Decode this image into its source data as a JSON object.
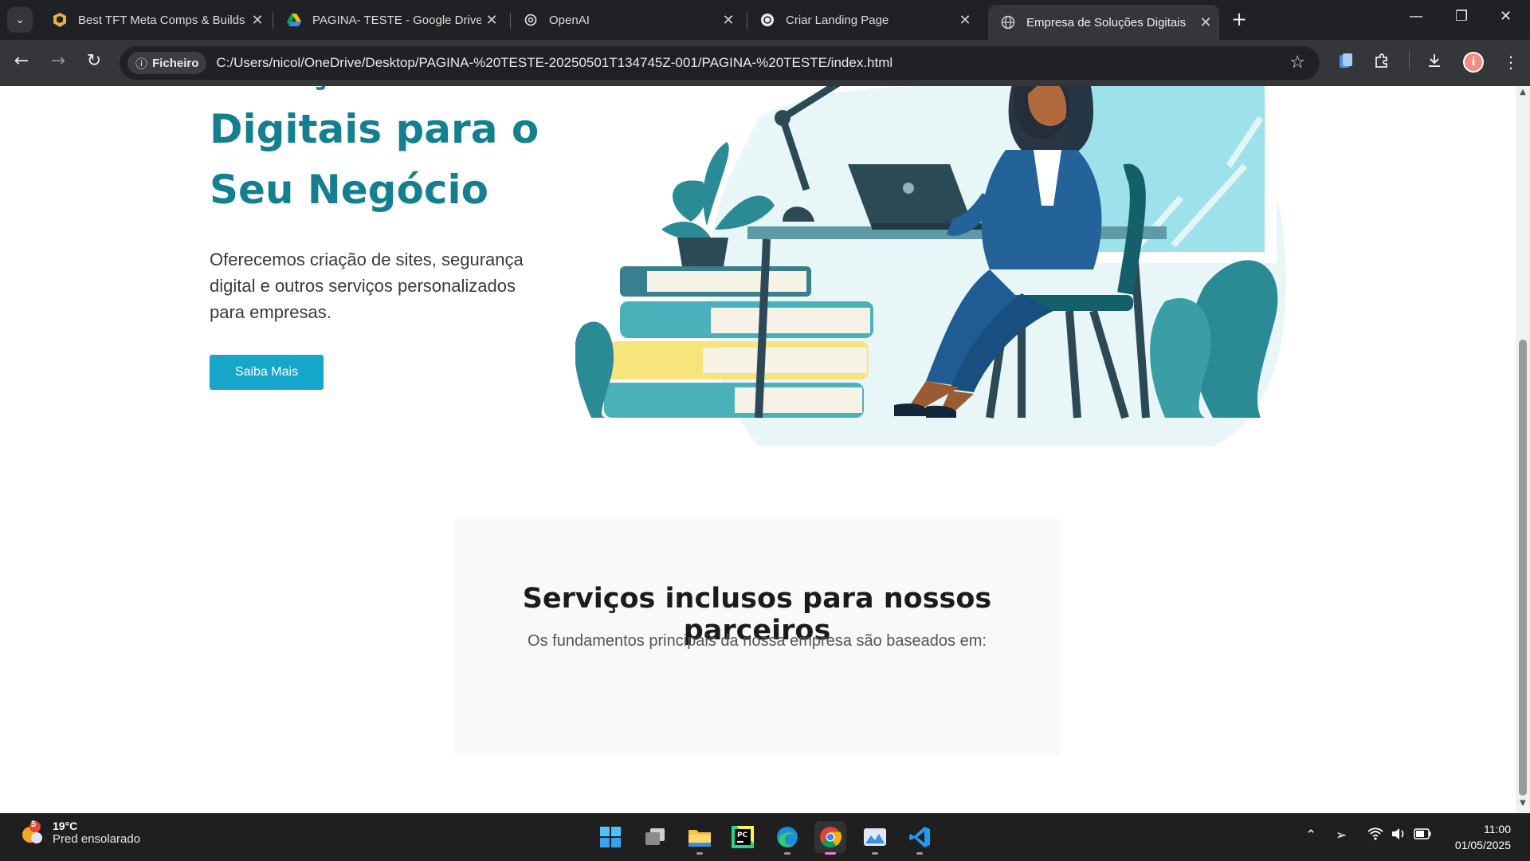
{
  "browser": {
    "tabs": [
      {
        "title": "Best TFT Meta Comps & Builds",
        "icon": "mobalytics-icon"
      },
      {
        "title": "PAGINA- TESTE - Google Drive",
        "icon": "google-drive-icon"
      },
      {
        "title": "OpenAI",
        "icon": "openai-icon"
      },
      {
        "title": "Criar Landing Page",
        "icon": "openai-icon"
      },
      {
        "title": "Empresa de Soluções Digitais",
        "icon": "globe-icon"
      }
    ],
    "active_tab": 4,
    "address_chip": "Ficheiro",
    "url": "C:/Users/nicol/OneDrive/Desktop/PAGINA-%20TESTE-20250501T134745Z-001/PAGINA-%20TESTE/index.html",
    "profile_initial": "i"
  },
  "page": {
    "hero": {
      "title": "Soluções Digitais para o Seu Negócio",
      "text": "Oferecemos criação de sites, segurança digital e outros serviços personalizados para empresas.",
      "button": "Saiba Mais"
    },
    "services": {
      "heading": "Serviços inclusos para nossos parceiros",
      "subtitle": "Os fundamentos principais da nossa empresa são baseados em:"
    }
  },
  "taskbar": {
    "weather": {
      "temp": "19°C",
      "condition": "Pred ensolarado",
      "badge": "5"
    },
    "apps": [
      "start-icon",
      "task-view-icon",
      "file-explorer-icon",
      "pycharm-icon",
      "edge-icon",
      "chrome-icon",
      "photos-icon",
      "vscode-icon"
    ],
    "clock": {
      "time": "11:00",
      "date": "01/05/2025"
    }
  },
  "colors": {
    "accent": "#14808f",
    "button": "#16a6c9",
    "chrome_dark": "#202124",
    "chrome_toolbar": "#35363a"
  }
}
